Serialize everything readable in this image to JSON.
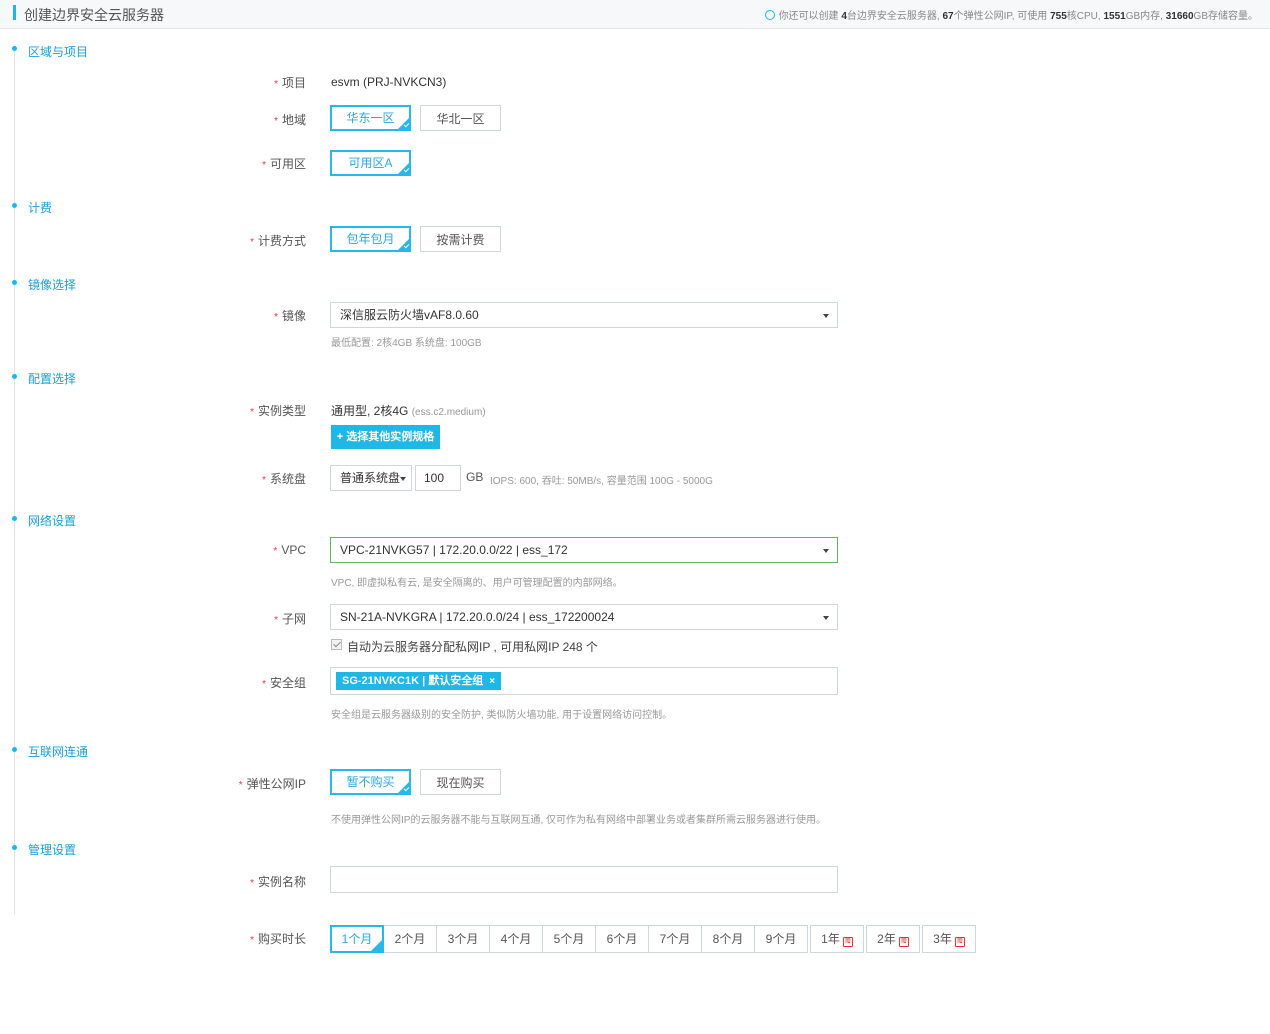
{
  "header": {
    "title": "创建边界安全云服务器",
    "quota": {
      "prefix": "你还可以创建",
      "servers": "4",
      "servers_unit": "台边界安全云服务器,",
      "ips": "67",
      "ips_unit": "个弹性公网IP, 可使用",
      "cpu": "755",
      "cpu_unit": "核CPU,",
      "mem": "1551",
      "mem_unit": "GB内存,",
      "storage": "31660",
      "storage_unit": "GB存储容量。"
    }
  },
  "sections": {
    "region": "区域与项目",
    "billing": "计费",
    "image": "镜像选择",
    "config": "配置选择",
    "network": "网络设置",
    "internet": "互联网连通",
    "manage": "管理设置"
  },
  "fields": {
    "project": {
      "label": "项目",
      "value": "esvm (PRJ-NVKCN3)"
    },
    "region": {
      "label": "地域",
      "options": [
        "华东一区",
        "华北一区"
      ],
      "selected": "华东一区"
    },
    "zone": {
      "label": "可用区",
      "options": [
        "可用区A"
      ],
      "selected": "可用区A"
    },
    "billing": {
      "label": "计费方式",
      "options": [
        "包年包月",
        "按需计费"
      ],
      "selected": "包年包月"
    },
    "image": {
      "label": "镜像",
      "value": "深信服云防火墙vAF8.0.60",
      "hint": "最低配置: 2核4GB 系统盘: 100GB"
    },
    "instance_type": {
      "label": "实例类型",
      "value": "通用型, 2核4G",
      "code": "(ess.c2.medium)",
      "button": "+ 选择其他实例规格"
    },
    "system_disk": {
      "label": "系统盘",
      "type": "普通系统盘",
      "size": "100",
      "unit": "GB",
      "hint": "IOPS: 600, 吞吐: 50MB/s, 容量范围 100G - 5000G"
    },
    "vpc": {
      "label": "VPC",
      "value": "VPC-21NVKG57 | 172.20.0.0/22 | ess_172",
      "hint": "VPC, 即虚拟私有云, 是安全隔离的、用户可管理配置的内部网络。"
    },
    "subnet": {
      "label": "子网",
      "value": "SN-21A-NVKGRA | 172.20.0.0/24 | ess_172200024",
      "checkbox_label": "自动为云服务器分配私网IP , 可用私网IP 248 个",
      "checked": true
    },
    "security_group": {
      "label": "安全组",
      "tag": "SG-21NVKC1K | 默认安全组",
      "tag_close": "×",
      "hint": "安全组是云服务器级别的安全防护, 类似防火墙功能, 用于设置网络访问控制。"
    },
    "eip": {
      "label": "弹性公网IP",
      "options": [
        "暂不购买",
        "现在购买"
      ],
      "selected": "暂不购买",
      "hint": "不使用弹性公网IP的云服务器不能与互联网互通, 仅可作为私有网络中部署业务或者集群所需云服务器进行使用。"
    },
    "instance_name": {
      "label": "实例名称",
      "value": ""
    },
    "duration": {
      "label": "购买时长",
      "options": [
        "1个月",
        "2个月",
        "3个月",
        "4个月",
        "5个月",
        "6个月",
        "7个月",
        "8个月",
        "9个月",
        "1年",
        "2年",
        "3年"
      ],
      "selected": "1个月",
      "gift_badge": "赠"
    }
  },
  "colors": {
    "accent": "#1fb7e6",
    "required": "#e4393c",
    "valid": "#5cb85c"
  }
}
